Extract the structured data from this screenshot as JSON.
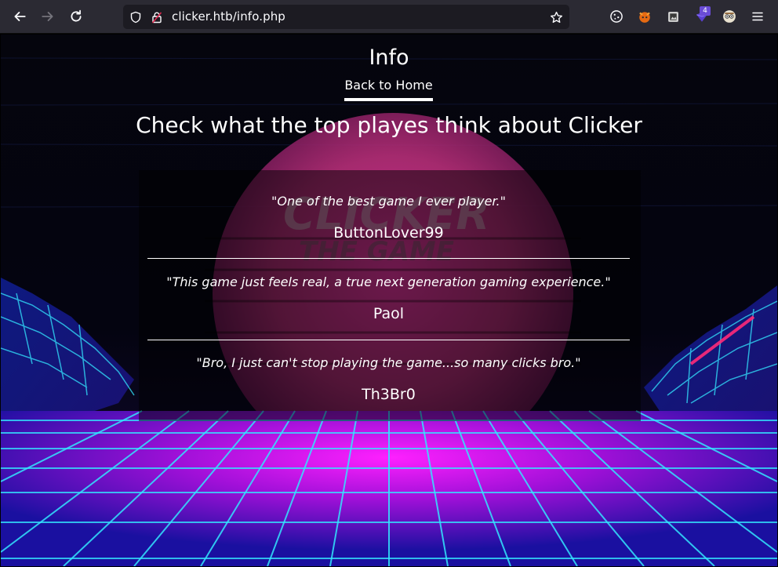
{
  "browser": {
    "url_host": "clicker.htb",
    "url_path": "/info.php",
    "extension_badge": "4"
  },
  "page": {
    "title": "Info",
    "home_link": "Back to Home",
    "heading": "Check what the top playes think about Clicker"
  },
  "reviews": [
    {
      "quote": "\"One of the best game I ever player.\"",
      "author": "ButtonLover99"
    },
    {
      "quote": "\"This game just feels real, a true next generation gaming experience.\"",
      "author": "Paol"
    },
    {
      "quote": "\"Bro, I just can't stop playing the game...so many clicks bro.\"",
      "author": "Th3Br0"
    }
  ],
  "colors": {
    "toolbar": "#2b2a33",
    "urlbar": "#1c1b22",
    "grid_magenta": "#ff22ff",
    "grid_cyan": "#33e6ff",
    "grid_blue": "#2a2aff"
  },
  "icons": [
    "back-icon",
    "forward-icon",
    "reload-icon",
    "shield-icon",
    "lock-icon",
    "star-icon",
    "cookie-icon",
    "fox-extension-icon",
    "image-extension-icon",
    "purple-extension-icon",
    "avatar-extension-icon",
    "menu-icon"
  ]
}
